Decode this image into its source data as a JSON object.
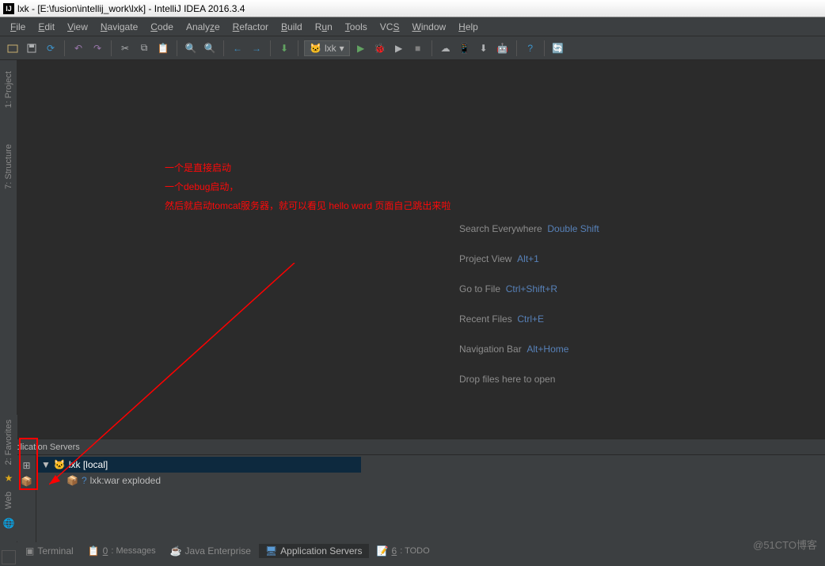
{
  "title": {
    "project": "lxk",
    "path": "[E:\\fusion\\intellij_work\\lxk]",
    "app": "IntelliJ IDEA 2016.3.4"
  },
  "menu": {
    "file": "File",
    "edit": "Edit",
    "view": "View",
    "navigate": "Navigate",
    "code": "Code",
    "analyze": "Analyze",
    "refactor": "Refactor",
    "build": "Build",
    "run": "Run",
    "tools": "Tools",
    "vcs": "VCS",
    "window": "Window",
    "help": "Help"
  },
  "toolbar": {
    "run_config": "lxk"
  },
  "left_gutter": {
    "project": "1: Project",
    "structure": "7: Structure"
  },
  "annotation": {
    "line1": "一个是直接启动",
    "line2": "一个debug启动，",
    "line3": "然后就启动tomcat服务器，就可以看见 hello word 页面自己跳出来啦"
  },
  "hints": {
    "search_label": "Search Everywhere",
    "search_key": "Double Shift",
    "project_label": "Project View",
    "project_key": "Alt+1",
    "goto_label": "Go to File",
    "goto_key": "Ctrl+Shift+R",
    "recent_label": "Recent Files",
    "recent_key": "Ctrl+E",
    "nav_label": "Navigation Bar",
    "nav_key": "Alt+Home",
    "drop": "Drop files here to open"
  },
  "app_servers": {
    "title": "Application Servers",
    "item1": "lxk [local]",
    "item2": "lxk:war exploded"
  },
  "bottom_gutter": {
    "favorites": "2: Favorites",
    "web": "Web"
  },
  "bottom_tabs": {
    "terminal": "Terminal",
    "messages": "0: Messages",
    "java_ee": "Java Enterprise",
    "app_servers": "Application Servers",
    "todo": "6: TODO"
  },
  "watermark": "@51CTO博客"
}
